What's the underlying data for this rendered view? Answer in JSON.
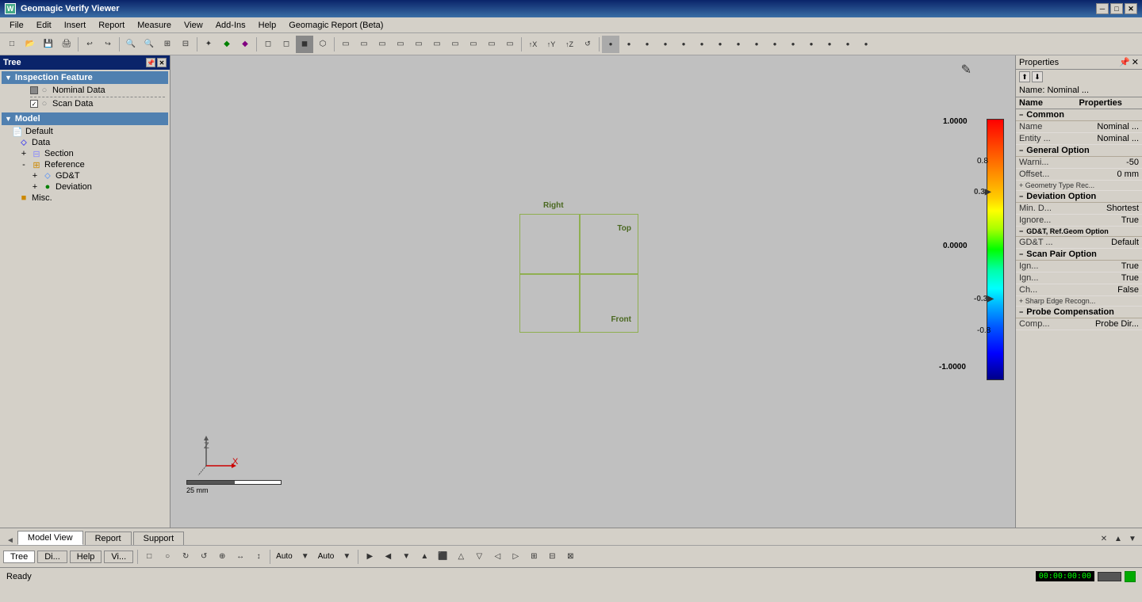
{
  "titlebar": {
    "title": "Geomagic Verify Viewer",
    "icon": "W",
    "min_btn": "─",
    "max_btn": "□",
    "close_btn": "✕"
  },
  "menubar": {
    "items": [
      "File",
      "Edit",
      "Insert",
      "Report",
      "Measure",
      "View",
      "Add-Ins",
      "Help",
      "Geomagic Report (Beta)"
    ]
  },
  "tree": {
    "title": "Tree",
    "inspection_section": {
      "label": "Inspection Feature",
      "items": [
        {
          "label": "Nominal Data",
          "checked": "partial",
          "icon": "○"
        },
        {
          "label": "Scan Data",
          "checked": "checked",
          "icon": "○"
        }
      ]
    },
    "model_section": {
      "label": "Model",
      "items": [
        {
          "label": "Default",
          "icon": "page",
          "indent": 0
        },
        {
          "label": "Data",
          "icon": "data",
          "indent": 1
        },
        {
          "label": "Section",
          "icon": "section",
          "indent": 1
        },
        {
          "label": "Reference",
          "icon": "ref",
          "indent": 1
        },
        {
          "label": "GD&T",
          "icon": "gdt",
          "indent": 2
        },
        {
          "label": "Deviation",
          "icon": "dev",
          "indent": 2
        },
        {
          "label": "Misc.",
          "icon": "misc",
          "indent": 1
        }
      ]
    }
  },
  "viewport": {
    "labels": {
      "right": "Right",
      "top": "Top",
      "front": "Front"
    },
    "scale": "25 mm"
  },
  "colorscale": {
    "max_val": "1.0000",
    "val_08": "0.8",
    "val_03": "0.3▶",
    "val_0": "0.0000",
    "val_n03": "-0.3",
    "val_n08": "-0.8",
    "val_n1": "-1.0000"
  },
  "properties": {
    "title": "Properties",
    "name_header": "Name: Nominal ...",
    "col1": "Name",
    "col2": "Properties",
    "sections": [
      {
        "label": "Common",
        "rows": [
          {
            "key": "Name",
            "val": "Nominal ..."
          },
          {
            "key": "Entity ...",
            "val": "Nominal ..."
          }
        ]
      },
      {
        "label": "General Option",
        "rows": [
          {
            "key": "Warni...",
            "val": "-50"
          },
          {
            "key": "Offset...",
            "val": "0 mm"
          },
          {
            "key": "+ Geometry Type Rec...",
            "val": ""
          }
        ]
      },
      {
        "label": "Deviation Option",
        "rows": [
          {
            "key": "Min. D...",
            "val": "Shortest"
          },
          {
            "key": "Ignore...",
            "val": "True"
          }
        ]
      },
      {
        "label": "GD&T, Ref.Geom Option",
        "rows": [
          {
            "key": "GD&T ...",
            "val": "Default"
          }
        ]
      },
      {
        "label": "Scan Pair Option",
        "rows": [
          {
            "key": "Ign...",
            "val": "True"
          },
          {
            "key": "Ign...",
            "val": "True"
          },
          {
            "key": "Ch...",
            "val": "False"
          },
          {
            "key": "+ Sharp Edge Recogn...",
            "val": ""
          }
        ]
      },
      {
        "label": "Probe Compensation",
        "rows": [
          {
            "key": "Comp...",
            "val": "Probe Dir..."
          }
        ]
      }
    ]
  },
  "bottom_tabs": {
    "model_view": "Model View",
    "report": "Report",
    "support": "Support"
  },
  "footer_tabs": [
    "Tree",
    "Di...",
    "Help",
    "Vi..."
  ],
  "statusbar": {
    "status": "Ready",
    "time": "00:00:00:00"
  },
  "bottom_toolbar": {
    "items": [
      "▣",
      "○",
      "↺",
      "↻",
      "⊕",
      "←",
      "→",
      "↑",
      "↓",
      "Auto",
      "Auto"
    ]
  }
}
